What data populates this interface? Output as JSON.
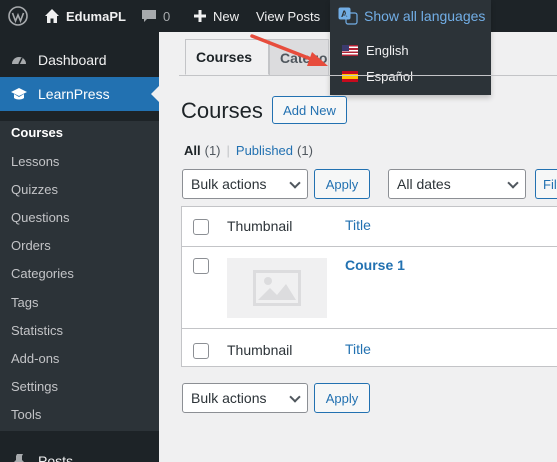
{
  "adminbar": {
    "site_name": "EdumaPL",
    "comments_count": "0",
    "new_label": "New",
    "view_posts_label": "View Posts"
  },
  "languages": {
    "show_all_label": "Show all languages",
    "items": [
      {
        "label": "English",
        "flag": "us-flag-icon"
      },
      {
        "label": "Español",
        "flag": "spain-flag-icon"
      }
    ]
  },
  "sidebar": {
    "dashboard_label": "Dashboard",
    "learnpress_label": "LearnPress",
    "submenu": [
      "Courses",
      "Lessons",
      "Quizzes",
      "Questions",
      "Orders",
      "Categories",
      "Tags",
      "Statistics",
      "Add-ons",
      "Settings",
      "Tools"
    ],
    "posts_label": "Posts"
  },
  "main": {
    "tabs": [
      "Courses",
      "Categories"
    ],
    "page_title": "Courses",
    "add_new_label": "Add New",
    "filters": {
      "all_label": "All",
      "all_count": "(1)",
      "separator": "|",
      "published_label": "Published",
      "published_count": "(1)"
    },
    "bulk_actions_label": "Bulk actions",
    "apply_label": "Apply",
    "dates_label": "All dates",
    "filter_label": "Filter",
    "table": {
      "col_thumbnail": "Thumbnail",
      "col_title": "Title",
      "rows": [
        {
          "title": "Course 1"
        }
      ]
    }
  },
  "colors": {
    "adminbar_bg": "#1d2327",
    "accent": "#2271b1",
    "annotation_arrow": "#e74c3c"
  }
}
